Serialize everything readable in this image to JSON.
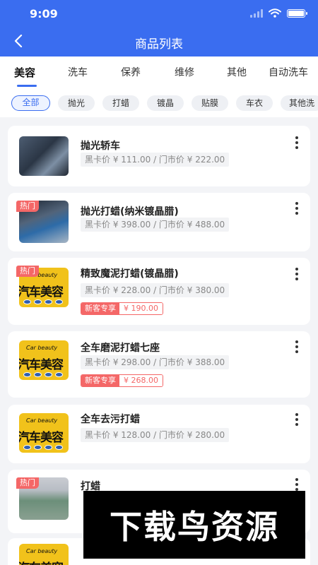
{
  "status_bar": {
    "time": "9:09"
  },
  "header": {
    "title": "商品列表"
  },
  "tabs": [
    "美容",
    "洗车",
    "保养",
    "维修",
    "其他",
    "自动洗车"
  ],
  "chips": [
    "全部",
    "抛光",
    "打蜡",
    "镀晶",
    "贴膜",
    "车衣",
    "其他洗"
  ],
  "hot_label": "热门",
  "logo_text": "汽车美容",
  "logo_sub": "Car beauty",
  "products": [
    {
      "name": "抛光轿车",
      "price": "黑卡价 ¥ 111.00 / 门市价 ¥ 222.00"
    },
    {
      "name": "抛光打蜡(纳米镀晶腊)",
      "price": "黑卡价 ¥ 398.00 / 门市价 ¥ 488.00"
    },
    {
      "name": "精致魔泥打蜡(镀晶腊)",
      "price": "黑卡价 ¥ 228.00 / 门市价 ¥ 380.00",
      "promo_label": "新客专享",
      "promo_price": "¥ 190.00"
    },
    {
      "name": "全车磨泥打蜡七座",
      "price": "黑卡价 ¥ 298.00 / 门市价 ¥ 388.00",
      "promo_label": "新客专享",
      "promo_price": "¥ 268.00"
    },
    {
      "name": "全车去污打蜡",
      "price": "黑卡价 ¥ 128.00 / 门市价 ¥ 280.00"
    },
    {
      "name": "打蜡"
    }
  ],
  "watermark": "下载鸟资源"
}
